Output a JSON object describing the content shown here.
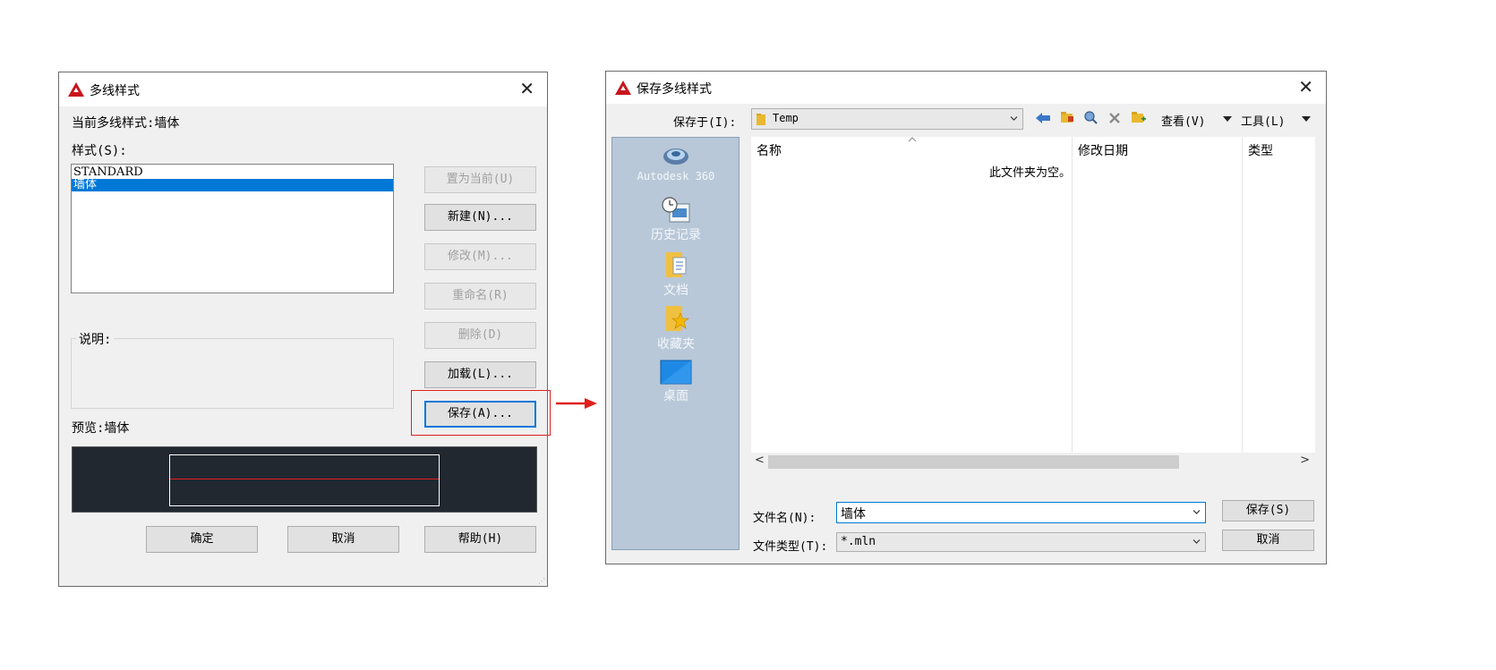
{
  "left_dialog": {
    "title": "多线样式",
    "close_glyph": "✕",
    "current_style": "当前多线样式:墙体",
    "styles_label": "样式(S):",
    "styles": [
      {
        "label": "STANDARD",
        "selected": false
      },
      {
        "label": "墙体",
        "selected": true
      }
    ],
    "buttons": {
      "set_current": "置为当前(U)",
      "new": "新建(N)...",
      "modify": "修改(M)...",
      "rename": "重命名(R)",
      "delete": "删除(D)",
      "load": "加载(L)...",
      "save": "保存(A)..."
    },
    "description_label": "说明:",
    "preview_label": "预览:墙体",
    "bottom_buttons": {
      "ok": "确定",
      "cancel": "取消",
      "help": "帮助(H)"
    }
  },
  "right_dialog": {
    "title": "保存多线样式",
    "close_glyph": "✕",
    "save_in_label": "保存于(I):",
    "save_in_value": "Temp",
    "toolbar": {
      "view_label": "查看(V)",
      "tools_label": "工具(L)"
    },
    "places": [
      {
        "label": "Autodesk 360",
        "icon": "autodesk-360-icon"
      },
      {
        "label": "历史记录",
        "icon": "history-icon"
      },
      {
        "label": "文档",
        "icon": "documents-icon"
      },
      {
        "label": "收藏夹",
        "icon": "favorites-icon"
      },
      {
        "label": "桌面",
        "icon": "desktop-icon"
      }
    ],
    "columns": {
      "name": "名称",
      "modified": "修改日期",
      "type": "类型"
    },
    "empty_text": "此文件夹为空。",
    "filename_label": "文件名(N):",
    "filename_value": "墙体",
    "filetype_label": "文件类型(T):",
    "filetype_value": "*.mln",
    "save_button": "保存(S)",
    "cancel_button": "取消"
  },
  "colors": {
    "accent": "#0078d7",
    "highlight_box": "#e02020",
    "preview_bg": "#212830",
    "places_bg": "#b8c8d8"
  }
}
